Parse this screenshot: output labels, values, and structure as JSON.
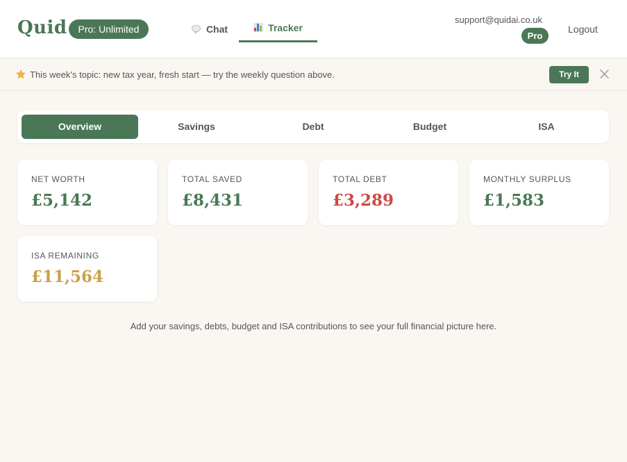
{
  "header": {
    "logo": "Quid",
    "plan_badge": "Pro: Unlimited",
    "nav": [
      {
        "label": "Chat",
        "icon": "speech-bubble-icon",
        "active": false
      },
      {
        "label": "Tracker",
        "icon": "bar-chart-icon",
        "active": true
      }
    ],
    "support_email": "support@quidai.co.uk",
    "pro_pill": "Pro",
    "logout_label": "Logout"
  },
  "banner": {
    "icon": "star-icon",
    "text": "This week's topic: new tax year, fresh start — try the weekly question above.",
    "try_label": "Try It",
    "close_icon": "close-icon"
  },
  "subtabs": [
    {
      "label": "Overview",
      "active": true
    },
    {
      "label": "Savings",
      "active": false
    },
    {
      "label": "Debt",
      "active": false
    },
    {
      "label": "Budget",
      "active": false
    },
    {
      "label": "ISA",
      "active": false
    }
  ],
  "cards": [
    {
      "label": "NET WORTH",
      "value": "£5,142",
      "color": "#4a7856"
    },
    {
      "label": "TOTAL SAVED",
      "value": "£8,431",
      "color": "#4a7856"
    },
    {
      "label": "TOTAL DEBT",
      "value": "£3,289",
      "color": "#cc4a44"
    },
    {
      "label": "MONTHLY SURPLUS",
      "value": "£1,583",
      "color": "#4a7856"
    },
    {
      "label": "ISA REMAINING",
      "value": "£11,564",
      "color": "#c9a24a"
    }
  ],
  "footer_note": "Add your savings, debts, budget and ISA contributions to see your full financial picture here.",
  "colors": {
    "accent": "#4a7856",
    "background": "#faf7f2",
    "debt": "#cc4a44",
    "isa": "#c9a24a"
  }
}
